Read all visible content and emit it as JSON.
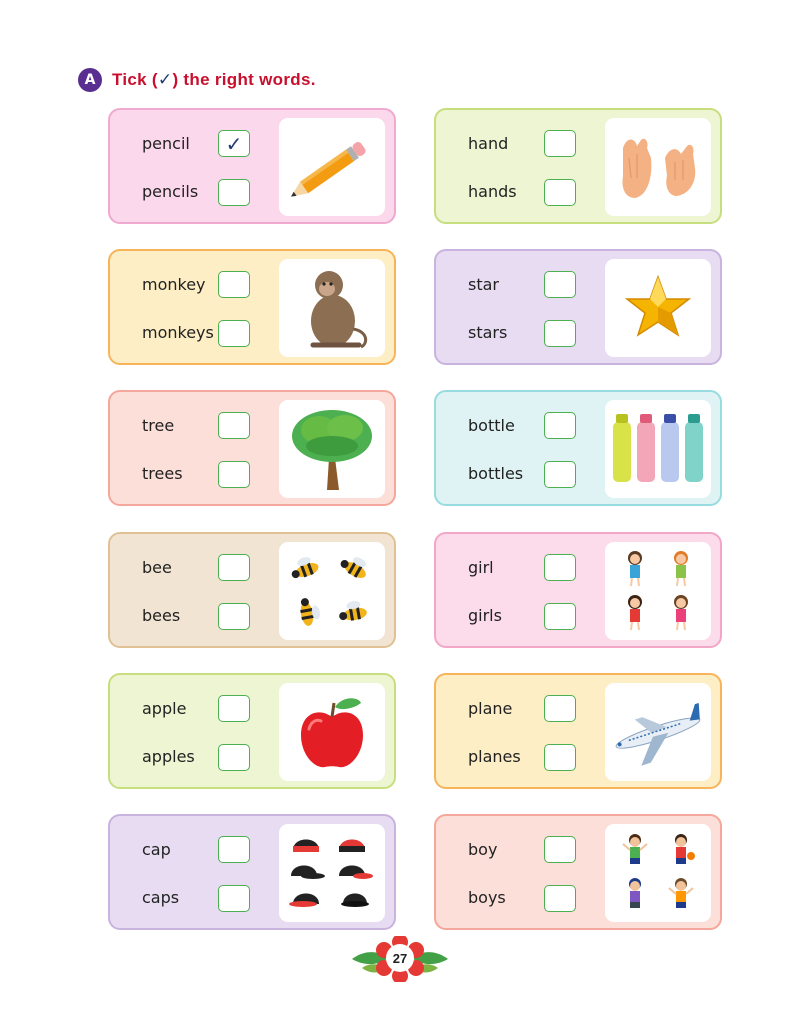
{
  "header": {
    "badge": "A",
    "instruction_before": "Tick (",
    "tick_symbol": "✓",
    "instruction_after": ") the right words."
  },
  "cards": [
    {
      "word1": "pencil",
      "word2": "pencils",
      "mark1": "✓",
      "mark2": "",
      "picture": "pencil-image",
      "bg": "#fcd8ec",
      "border": "#f0a9cf"
    },
    {
      "word1": "hand",
      "word2": "hands",
      "mark1": "",
      "mark2": "",
      "picture": "hands-image",
      "bg": "#eef5d2",
      "border": "#c6de7e"
    },
    {
      "word1": "monkey",
      "word2": "monkeys",
      "mark1": "",
      "mark2": "",
      "picture": "monkey-image",
      "bg": "#fdeec5",
      "border": "#f7b45b"
    },
    {
      "word1": "star",
      "word2": "stars",
      "mark1": "",
      "mark2": "",
      "picture": "star-image",
      "bg": "#e7dcf1",
      "border": "#c9b3df"
    },
    {
      "word1": "tree",
      "word2": "trees",
      "mark1": "",
      "mark2": "",
      "picture": "tree-image",
      "bg": "#fddfd9",
      "border": "#f4a79a"
    },
    {
      "word1": "bottle",
      "word2": "bottles",
      "mark1": "",
      "mark2": "",
      "picture": "bottles-image",
      "bg": "#dff3f4",
      "border": "#98dbe0"
    },
    {
      "word1": "bee",
      "word2": "bees",
      "mark1": "",
      "mark2": "",
      "picture": "bees-image",
      "bg": "#f1e4d3",
      "border": "#e0c195"
    },
    {
      "word1": "girl",
      "word2": "girls",
      "mark1": "",
      "mark2": "",
      "picture": "girls-image",
      "bg": "#fcdcea",
      "border": "#f2a6c8"
    },
    {
      "word1": "apple",
      "word2": "apples",
      "mark1": "",
      "mark2": "",
      "picture": "apple-image",
      "bg": "#eef5d2",
      "border": "#c6de7e"
    },
    {
      "word1": "plane",
      "word2": "planes",
      "mark1": "",
      "mark2": "",
      "picture": "plane-image",
      "bg": "#fdeec5",
      "border": "#f7b45b"
    },
    {
      "word1": "cap",
      "word2": "caps",
      "mark1": "",
      "mark2": "",
      "picture": "caps-image",
      "bg": "#e7dcf1",
      "border": "#c9b3df"
    },
    {
      "word1": "boy",
      "word2": "boys",
      "mark1": "",
      "mark2": "",
      "picture": "boys-image",
      "bg": "#fddfd9",
      "border": "#f4a79a"
    }
  ],
  "footer": {
    "page_number": "27",
    "decoration": "flower-leaves-icon"
  }
}
